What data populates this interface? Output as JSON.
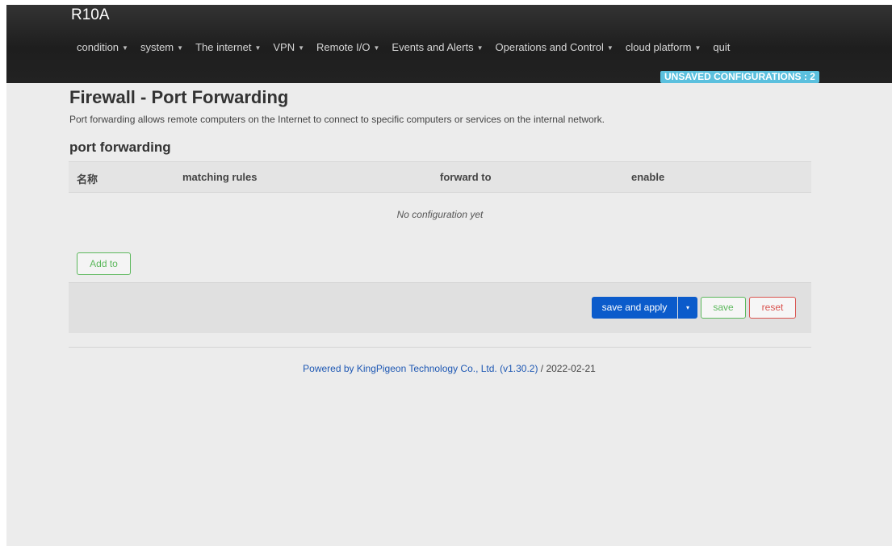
{
  "app": {
    "brand": "R10A"
  },
  "menu": [
    {
      "label": "condition",
      "dropdown": true
    },
    {
      "label": "system",
      "dropdown": true
    },
    {
      "label": "The internet",
      "dropdown": true
    },
    {
      "label": "VPN",
      "dropdown": true
    },
    {
      "label": "Remote I/O",
      "dropdown": true
    },
    {
      "label": "Events and Alerts",
      "dropdown": true
    },
    {
      "label": "Operations and Control",
      "dropdown": true
    },
    {
      "label": "cloud platform",
      "dropdown": true
    },
    {
      "label": "quit",
      "dropdown": false
    }
  ],
  "badge": {
    "unsaved": "UNSAVED CONFIGURATIONS : 2",
    "color": "#5bc0de"
  },
  "page": {
    "title": "Firewall - Port Forwarding",
    "description": "Port forwarding allows remote computers on the Internet to connect to specific computers or services on the internal network."
  },
  "section": {
    "title": "port forwarding"
  },
  "table": {
    "columns": [
      "名称",
      "matching rules",
      "forward to",
      "enable"
    ],
    "empty_text": "No configuration yet"
  },
  "buttons": {
    "add": "Add to",
    "save_apply": "save and apply",
    "save_apply_toggle_icon": "▾",
    "save": "save",
    "reset": "reset"
  },
  "colors": {
    "primary": "#0b5bcb",
    "success": "#5cb85c",
    "danger": "#d9534f",
    "link": "#1d57b3"
  },
  "footer": {
    "link_text": "Powered by KingPigeon Technology Co., Ltd. (v1.30.2)",
    "suffix": " / 2022-02-21"
  }
}
